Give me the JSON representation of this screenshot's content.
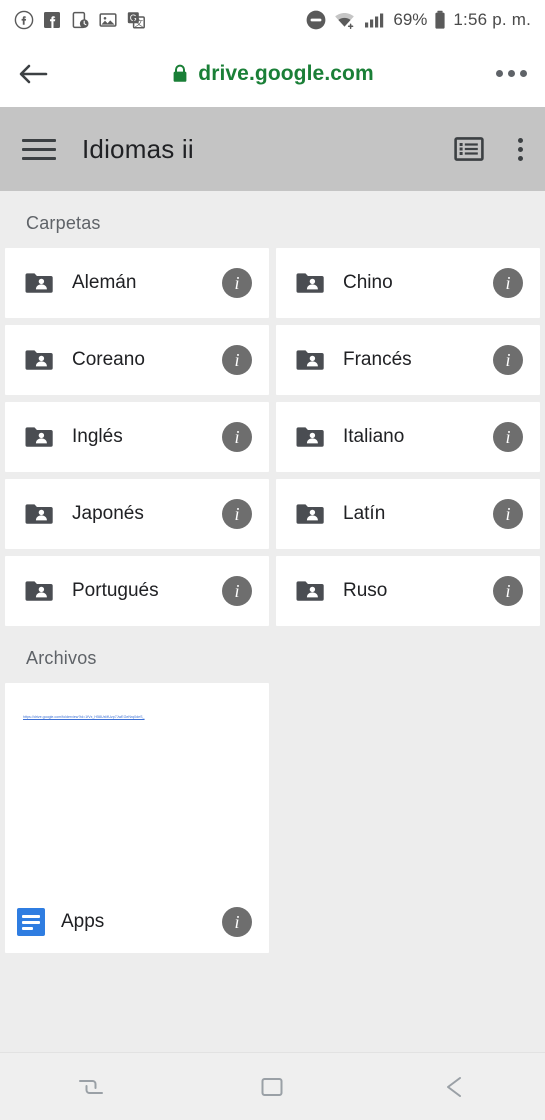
{
  "status_bar": {
    "left_icons": [
      "facebook-circle-icon",
      "facebook-square-icon",
      "device-clock-icon",
      "photo-icon",
      "google-translate-icon"
    ],
    "dnd_icon": "do-not-disturb-icon",
    "wifi_icon": "wifi-plus-icon",
    "signal_icon": "cellular-signal-icon",
    "battery_percent": "69%",
    "battery_icon": "battery-icon",
    "time": "1:56 p. m."
  },
  "browser": {
    "back_icon": "back-arrow-icon",
    "lock_icon": "lock-icon",
    "url": "drive.google.com",
    "menu_icon": "overflow-menu-icon"
  },
  "app_bar": {
    "menu_icon": "hamburger-menu-icon",
    "title": "Idiomas ii",
    "view_toggle_icon": "list-view-icon",
    "overflow_icon": "kebab-menu-icon"
  },
  "sections": {
    "folders_label": "Carpetas",
    "files_label": "Archivos"
  },
  "folders": [
    {
      "name": "Alemán",
      "icon": "shared-folder-icon",
      "info": "info-icon"
    },
    {
      "name": "Chino",
      "icon": "shared-folder-icon",
      "info": "info-icon"
    },
    {
      "name": "Coreano",
      "icon": "shared-folder-icon",
      "info": "info-icon"
    },
    {
      "name": "Francés",
      "icon": "shared-folder-icon",
      "info": "info-icon"
    },
    {
      "name": "Inglés",
      "icon": "shared-folder-icon",
      "info": "info-icon"
    },
    {
      "name": "Italiano",
      "icon": "shared-folder-icon",
      "info": "info-icon"
    },
    {
      "name": "Japonés",
      "icon": "shared-folder-icon",
      "info": "info-icon"
    },
    {
      "name": "Latín",
      "icon": "shared-folder-icon",
      "info": "info-icon"
    },
    {
      "name": "Portugués",
      "icon": "shared-folder-icon",
      "info": "info-icon"
    },
    {
      "name": "Ruso",
      "icon": "shared-folder-icon",
      "info": "info-icon"
    }
  ],
  "files": [
    {
      "name": "Apps",
      "icon": "google-docs-icon",
      "info": "info-icon",
      "preview_link": "https://drive.google.com/folderview?id=1fVx_H58UxMUzp7JwEGeNrq0deS_"
    }
  ],
  "nav_bar": {
    "recents_icon": "recents-icon",
    "home_icon": "home-icon",
    "back_icon": "back-icon"
  },
  "colors": {
    "url_green": "#1a7f37",
    "appbar_gray": "#c4c4c4",
    "page_bg": "#ededed",
    "card_white": "#ffffff",
    "folder_gray": "#4a4d52",
    "docs_blue": "#2f7de1",
    "info_gray": "#6e6e6e"
  }
}
